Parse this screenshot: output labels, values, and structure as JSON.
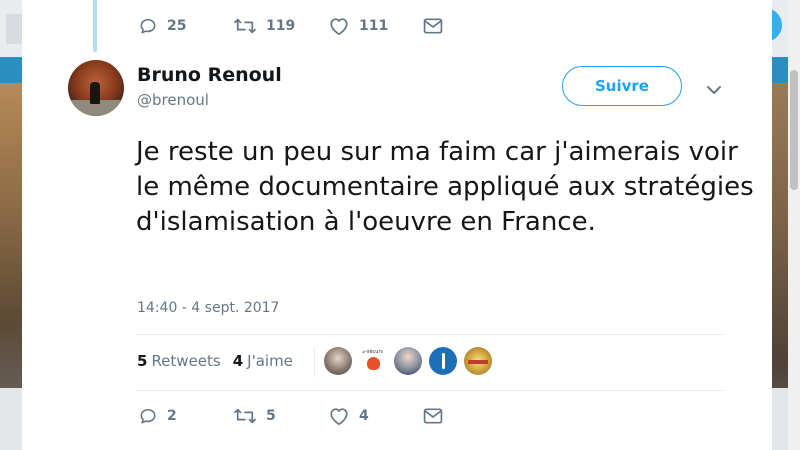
{
  "previous_tweet_actions": {
    "reply_count": "25",
    "retweet_count": "119",
    "like_count": "111"
  },
  "author": {
    "name": "Bruno Renoul",
    "handle": "@brenoul"
  },
  "follow_button_label": "Suivre",
  "tweet": {
    "text": "Je reste un peu sur ma faim car j'aimerais voir le même documentaire appliqué aux stratégies d'islamisation à l'oeuvre en France.",
    "timestamp": "14:40 - 4 sept. 2017"
  },
  "stats": {
    "retweets_count": "5",
    "retweets_label": "Retweets",
    "likes_count": "4",
    "likes_label": "J'aime"
  },
  "likers": [
    {
      "icon": "avatar-photo-woman"
    },
    {
      "icon": "avatar-logo-bird",
      "label": "e-sécurin"
    },
    {
      "icon": "avatar-photo-group"
    },
    {
      "icon": "avatar-blue-logo"
    },
    {
      "icon": "avatar-cartoon"
    }
  ],
  "tweet_actions": {
    "reply_count": "2",
    "retweet_count": "5",
    "like_count": "4"
  },
  "colors": {
    "accent": "#1da1f2",
    "text": "#14171a",
    "secondary_text": "#657786",
    "thread_line": "#b5dcf6"
  }
}
